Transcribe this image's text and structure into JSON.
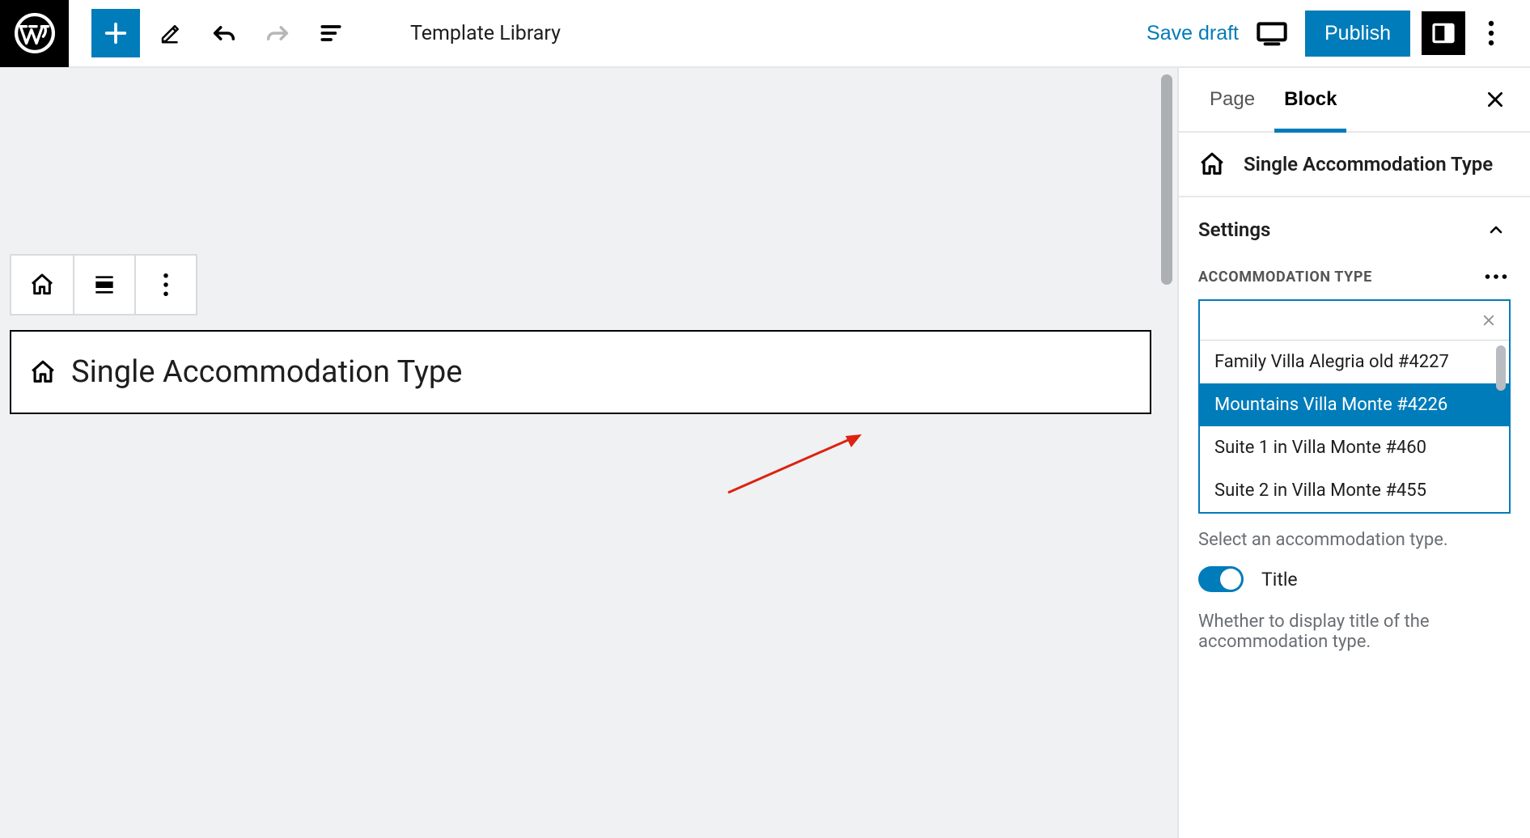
{
  "header": {
    "template_library": "Template Library",
    "save_draft": "Save draft",
    "publish": "Publish"
  },
  "canvas": {
    "block_type_label": "Single Accommodation Type"
  },
  "sidebar": {
    "tabs": {
      "page": "Page",
      "block": "Block"
    },
    "block_card_title": "Single Accommodation Type",
    "panel_settings": "Settings",
    "acc_type_label": "ACCOMMODATION TYPE",
    "options": [
      "Family Villa Alegria old #4227",
      "Mountains Villa Monte #4226",
      "Suite 1 in Villa Monte #460",
      "Suite 2 in Villa Monte #455"
    ],
    "selected_index": 1,
    "help_select": "Select an accommodation type.",
    "toggle_title_label": "Title",
    "help_toggle": "Whether to display title of the accommodation type."
  },
  "colors": {
    "accent": "#007cba"
  }
}
